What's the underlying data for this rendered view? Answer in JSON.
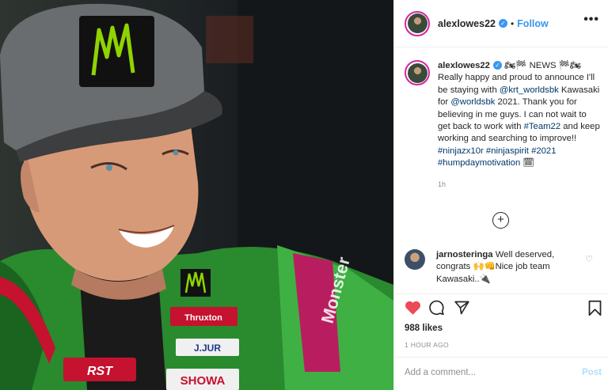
{
  "post": {
    "username": "alexlowes22",
    "follow_label": "Follow",
    "header_separator": "•",
    "more_label": "•••"
  },
  "photo": {
    "cap_logo": "M",
    "suit_brand_1": "Monster",
    "suit_brand_2": "RST",
    "suit_brand_3": "SHOWA",
    "suit_brand_4": "J.JUR",
    "suit_brand_5": "Thruxton"
  },
  "caption": {
    "username": "alexlowes22",
    "t1": " 🏍🏁 NEWS 🏁🏍 Really happy and proud to announce I'll be staying with ",
    "m1": "@krt_worldsbk",
    "t2": " Kawasaki for ",
    "m2": "@worldsbk",
    "t3": " 2021. Thank you for believing in me guys. I can not wait to get back to work with ",
    "h1": "#Team22",
    "t4": " and keep working and searching to improve!! ",
    "h2": "#ninjazx10r",
    "h3": "#ninjaspirit",
    "h4": "#2021",
    "h5": "#humpdaymotivation",
    "t5": " 🗓",
    "time": "1h"
  },
  "load_more_label": "+",
  "comment": {
    "username": "jarnosteringa",
    "text": " Well deserved, congrats 🙌👊Nice job team Kawasaki..🔌"
  },
  "actions": {
    "likes": "988 likes",
    "posted_ago": "1 HOUR AGO"
  },
  "add_comment": {
    "placeholder": "Add a comment...",
    "post_label": "Post"
  },
  "colors": {
    "accent_link": "#3897f0",
    "heart_red": "#ed4956",
    "post_disabled": "#b2dffc",
    "kawasaki_green": "#4fb848",
    "monster_green": "#8fd400"
  }
}
